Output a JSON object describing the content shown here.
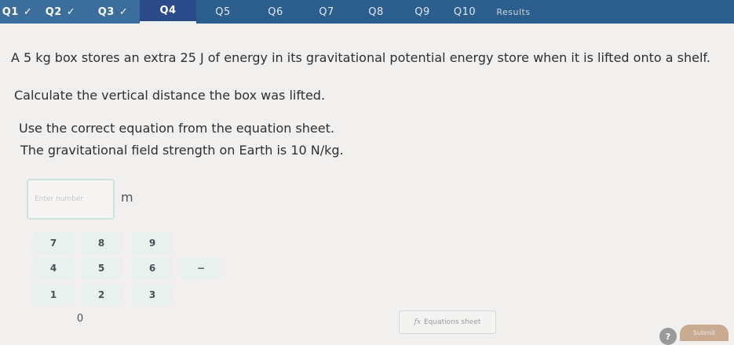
{
  "tabs": [
    {
      "label": "Q1",
      "state": "done"
    },
    {
      "label": "Q2",
      "state": "done"
    },
    {
      "label": "Q3",
      "state": "done"
    },
    {
      "label": "Q4",
      "state": "active"
    },
    {
      "label": "Q5",
      "state": "pending"
    },
    {
      "label": "Q6",
      "state": "pending"
    },
    {
      "label": "Q7",
      "state": "pending"
    },
    {
      "label": "Q8",
      "state": "pending"
    },
    {
      "label": "Q9",
      "state": "pending"
    },
    {
      "label": "Q10",
      "state": "pending"
    },
    {
      "label": "Results",
      "state": "results"
    }
  ],
  "check_glyph": "✓",
  "question": {
    "line1": "A 5 kg box stores an extra 25 J of energy in its gravitational potential energy store when it is lifted onto a shelf.",
    "line2": "Calculate the vertical distance the box was lifted.",
    "line3": "Use the correct equation from the equation sheet.",
    "line4": "The gravitational field strength on Earth is 10 N/kg."
  },
  "answer": {
    "placeholder": "Enter number",
    "value": "",
    "unit": "m"
  },
  "keypad": {
    "k7": "7",
    "k8": "8",
    "k9": "9",
    "k4": "4",
    "k5": "5",
    "k6": "6",
    "minus": "−",
    "k1": "1",
    "k2": "2",
    "k3": "3",
    "k0": "0"
  },
  "equation_sheet": {
    "icon": "fx",
    "label": "Equations sheet"
  },
  "help_label": "?",
  "submit_label": "Submit",
  "colors": {
    "tabbar": "#2b5e8c",
    "keypad_bg": "#e8f1ee",
    "submit": "#c9ab91"
  }
}
